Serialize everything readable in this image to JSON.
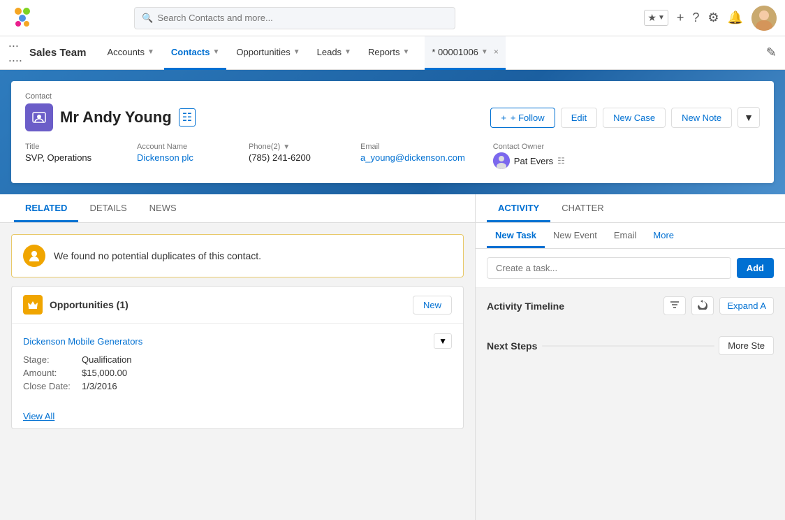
{
  "app": {
    "name": "Sales Team",
    "search_placeholder": "Search Contacts and more..."
  },
  "nav": {
    "items": [
      {
        "label": "Accounts",
        "has_chevron": true,
        "active": false
      },
      {
        "label": "Contacts",
        "has_chevron": true,
        "active": true
      },
      {
        "label": "Opportunities",
        "has_chevron": true,
        "active": false
      },
      {
        "label": "Leads",
        "has_chevron": true,
        "active": false
      },
      {
        "label": "Reports",
        "has_chevron": true,
        "active": false
      }
    ],
    "tab": {
      "id": "* 00001006",
      "close": "×"
    }
  },
  "contact": {
    "breadcrumb": "Contact",
    "name": "Mr Andy Young",
    "title": "SVP, Operations",
    "account_name": "Dickenson plc",
    "phone_label": "Phone(2)",
    "phone": "(785) 241-6200",
    "email_label": "Email",
    "email": "a_young@dickenson.com",
    "owner_label": "Contact Owner",
    "owner_name": "Pat Evers",
    "title_label": "Title",
    "account_label": "Account Name"
  },
  "actions": {
    "follow": "+ Follow",
    "edit": "Edit",
    "new_case": "New Case",
    "new_note": "New Note"
  },
  "tabs_left": {
    "related": "RELATED",
    "details": "DETAILS",
    "news": "NEWS"
  },
  "tabs_right": {
    "activity": "ACTIVITY",
    "chatter": "CHATTER"
  },
  "alert": {
    "text": "We found no potential duplicates of this contact."
  },
  "opportunities": {
    "title": "Opportunities (1)",
    "new_btn": "New",
    "name": "Dickenson Mobile Generators",
    "stage_label": "Stage:",
    "stage_value": "Qualification",
    "amount_label": "Amount:",
    "amount_value": "$15,000.00",
    "close_label": "Close Date:",
    "close_value": "1/3/2016",
    "view_all": "View All"
  },
  "activity": {
    "sub_tabs": [
      {
        "label": "New Task",
        "active": true
      },
      {
        "label": "New Event",
        "active": false
      },
      {
        "label": "Email",
        "active": false
      },
      {
        "label": "More",
        "active": false
      }
    ],
    "task_placeholder": "Create a task...",
    "add_btn": "Add",
    "timeline_title": "Activity Timeline",
    "expand_btn": "Expand A",
    "next_steps_title": "Next Steps",
    "more_steps_btn": "More Ste"
  }
}
